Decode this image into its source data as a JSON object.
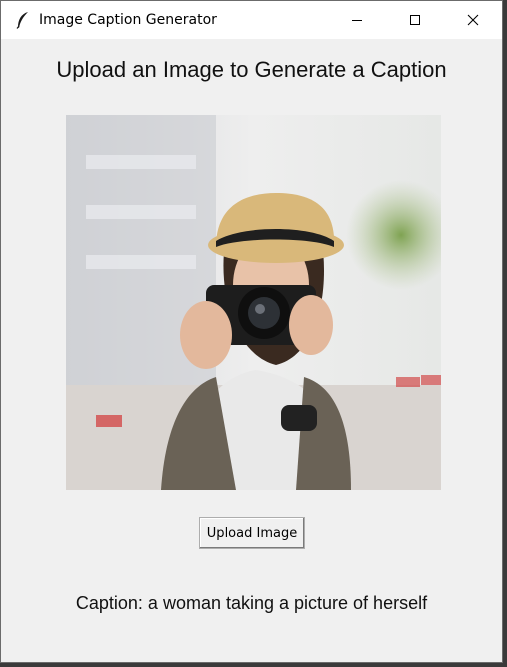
{
  "window": {
    "title": "Image Caption Generator",
    "app_icon": "feather-icon",
    "controls": [
      "minimize-icon",
      "maximize-icon",
      "close-icon"
    ]
  },
  "main": {
    "heading": "Upload an Image to Generate a Caption",
    "image_subject": "photo-image",
    "upload_button_label": "Upload Image",
    "caption_text": "Caption: a woman taking a picture of herself"
  },
  "colors": {
    "window_bg": "#f0f0f0",
    "titlebar_bg": "#ffffff",
    "text": "#111111"
  }
}
